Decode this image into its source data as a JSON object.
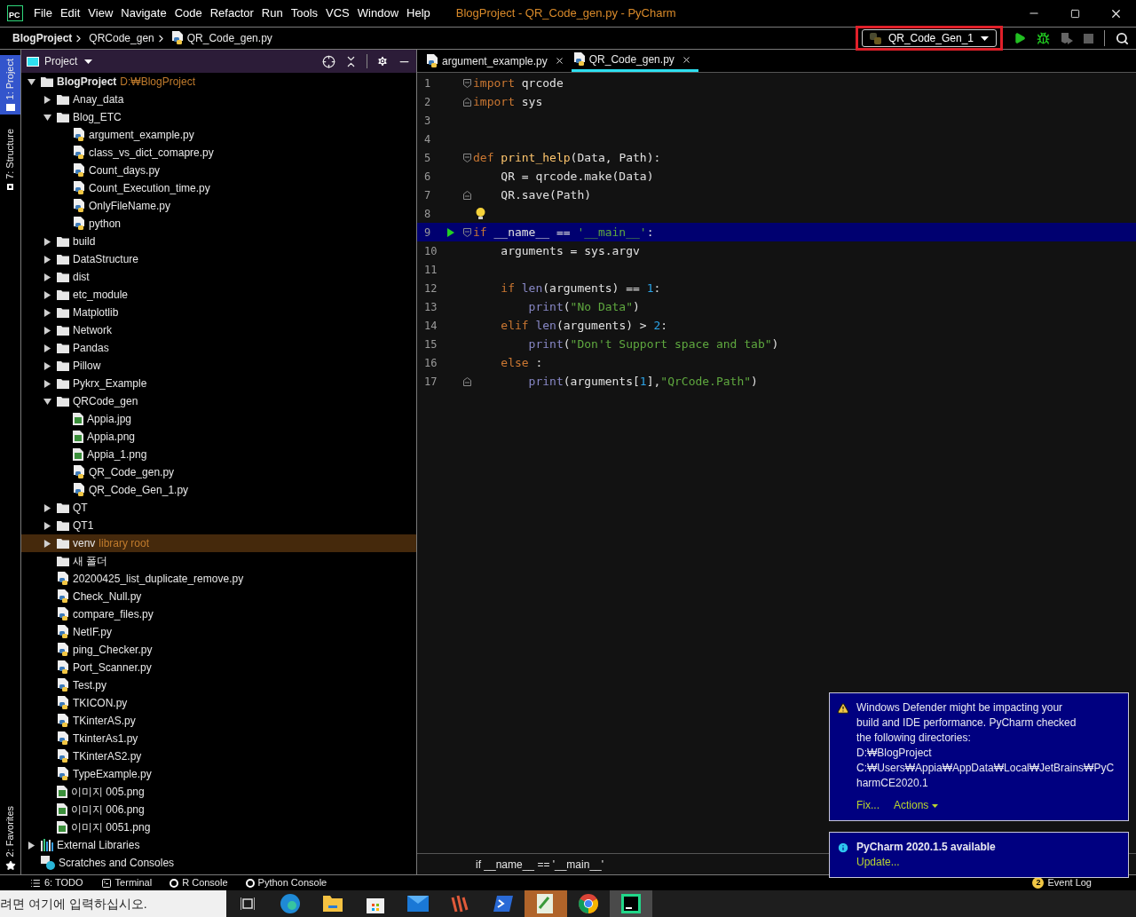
{
  "title_bar": {
    "logo": "PC",
    "menu": [
      "File",
      "Edit",
      "View",
      "Navigate",
      "Code",
      "Refactor",
      "Run",
      "Tools",
      "VCS",
      "Window",
      "Help"
    ],
    "title": "BlogProject - QR_Code_gen.py - PyCharm"
  },
  "nav_bar": {
    "breadcrumbs": [
      "BlogProject",
      "QRCode_gen",
      "QR_Code_gen.py"
    ],
    "run_config": "QR_Code_Gen_1"
  },
  "side_tabs": [
    {
      "label": "1: Project",
      "selected": true
    },
    {
      "label": "7: Structure",
      "selected": false
    }
  ],
  "favorites_tab": {
    "label": "2: Favorites"
  },
  "project_panel": {
    "title": "Project",
    "tree": [
      {
        "label": "BlogProject",
        "kind": "folder",
        "suffix": "D:₩BlogProject",
        "expanded": true,
        "selected": false,
        "children": [
          {
            "label": "Anay_data",
            "kind": "folder",
            "expanded": false,
            "selected": false
          },
          {
            "label": "Blog_ETC",
            "kind": "folder",
            "expanded": true,
            "selected": false,
            "children": [
              {
                "label": "argument_example.py",
                "kind": "python",
                "selected": false
              },
              {
                "label": "class_vs_dict_comapre.py",
                "kind": "python",
                "selected": false
              },
              {
                "label": "Count_days.py",
                "kind": "python",
                "selected": false
              },
              {
                "label": "Count_Execution_time.py",
                "kind": "python",
                "selected": false
              },
              {
                "label": "OnlyFileName.py",
                "kind": "python",
                "selected": false
              },
              {
                "label": "python",
                "kind": "python",
                "selected": false
              }
            ]
          },
          {
            "label": "build",
            "kind": "folder",
            "expanded": false,
            "selected": false
          },
          {
            "label": "DataStructure",
            "kind": "folder",
            "expanded": false,
            "selected": false
          },
          {
            "label": "dist",
            "kind": "folder",
            "expanded": false,
            "selected": false
          },
          {
            "label": "etc_module",
            "kind": "folder",
            "expanded": false,
            "selected": false
          },
          {
            "label": "Matplotlib",
            "kind": "folder",
            "expanded": false,
            "selected": false
          },
          {
            "label": "Network",
            "kind": "folder",
            "expanded": false,
            "selected": false
          },
          {
            "label": "Pandas",
            "kind": "folder",
            "expanded": false,
            "selected": false
          },
          {
            "label": "Pillow",
            "kind": "folder",
            "expanded": false,
            "selected": false
          },
          {
            "label": "Pykrx_Example",
            "kind": "folder",
            "expanded": false,
            "selected": false
          },
          {
            "label": "QRCode_gen",
            "kind": "folder",
            "expanded": true,
            "selected": false,
            "children": [
              {
                "label": "Appia.jpg",
                "kind": "image",
                "selected": false
              },
              {
                "label": "Appia.png",
                "kind": "image",
                "selected": false
              },
              {
                "label": "Appia_1.png",
                "kind": "image",
                "selected": false
              },
              {
                "label": "QR_Code_gen.py",
                "kind": "python",
                "selected": false
              },
              {
                "label": "QR_Code_Gen_1.py",
                "kind": "python",
                "selected": false
              }
            ]
          },
          {
            "label": "QT",
            "kind": "folder",
            "expanded": false,
            "selected": false
          },
          {
            "label": "QT1",
            "kind": "folder",
            "expanded": false,
            "selected": false
          },
          {
            "label": "venv",
            "kind": "folder",
            "suffix": "library root",
            "expanded": false,
            "selected": true
          },
          {
            "label": "새 폴더",
            "kind": "folder",
            "selected": false
          },
          {
            "label": "20200425_list_duplicate_remove.py",
            "kind": "python",
            "selected": false
          },
          {
            "label": "Check_Null.py",
            "kind": "python",
            "selected": false
          },
          {
            "label": "compare_files.py",
            "kind": "python",
            "selected": false
          },
          {
            "label": "NetIF.py",
            "kind": "python",
            "selected": false
          },
          {
            "label": "ping_Checker.py",
            "kind": "python",
            "selected": false
          },
          {
            "label": "Port_Scanner.py",
            "kind": "python",
            "selected": false
          },
          {
            "label": "Test.py",
            "kind": "python",
            "selected": false
          },
          {
            "label": "TKICON.py",
            "kind": "python",
            "selected": false
          },
          {
            "label": "TKinterAS.py",
            "kind": "python",
            "selected": false
          },
          {
            "label": "TkinterAs1.py",
            "kind": "python",
            "selected": false
          },
          {
            "label": "TKinterAS2.py",
            "kind": "python",
            "selected": false
          },
          {
            "label": "TypeExample.py",
            "kind": "python",
            "selected": false
          },
          {
            "label": "이미지 005.png",
            "kind": "image",
            "selected": false
          },
          {
            "label": "이미지 006.png",
            "kind": "image",
            "selected": false
          },
          {
            "label": "이미지 0051.png",
            "kind": "image",
            "selected": false
          }
        ]
      },
      {
        "label": "External Libraries",
        "kind": "library",
        "expanded": false,
        "selected": false
      },
      {
        "label": "Scratches and Consoles",
        "kind": "scratch",
        "selected": false
      }
    ]
  },
  "editor": {
    "tabs": [
      {
        "label": "argument_example.py",
        "selected": false
      },
      {
        "label": "QR_Code_gen.py",
        "selected": true
      }
    ],
    "lines": [
      {
        "n": "1",
        "fold": {
          "kind": "start"
        },
        "current": false,
        "run": false,
        "bulb": false,
        "tokens": [
          {
            "kind": "kw",
            "text": "import "
          },
          {
            "kind": "plain",
            "text": "qrcode"
          }
        ]
      },
      {
        "n": "2",
        "fold": {
          "kind": "end"
        },
        "current": false,
        "run": false,
        "bulb": false,
        "tokens": [
          {
            "kind": "kw",
            "text": "import "
          },
          {
            "kind": "plain",
            "text": "sys"
          }
        ]
      },
      {
        "n": "3",
        "current": false,
        "run": false,
        "bulb": false
      },
      {
        "n": "4",
        "current": false,
        "run": false,
        "bulb": false
      },
      {
        "n": "5",
        "fold": {
          "kind": "start"
        },
        "current": false,
        "run": false,
        "bulb": false,
        "tokens": [
          {
            "kind": "kw",
            "text": "def "
          },
          {
            "kind": "fn",
            "text": "print_help"
          },
          {
            "kind": "plain",
            "text": "(Data, Path):"
          }
        ]
      },
      {
        "n": "6",
        "current": false,
        "run": false,
        "bulb": false,
        "tokens": [
          {
            "kind": "plain",
            "text": "    QR = qrcode.make(Data)"
          }
        ]
      },
      {
        "n": "7",
        "fold": {
          "kind": "end"
        },
        "current": false,
        "run": false,
        "bulb": false,
        "tokens": [
          {
            "kind": "plain",
            "text": "    QR.save(Path)"
          }
        ]
      },
      {
        "n": "8",
        "current": false,
        "run": false,
        "bulb": true
      },
      {
        "n": "9",
        "fold": {
          "kind": "start"
        },
        "current": true,
        "run": true,
        "bulb": false,
        "tokens": [
          {
            "kind": "kw",
            "text": "if "
          },
          {
            "kind": "plain",
            "text": "__name__ == "
          },
          {
            "kind": "str",
            "text": "'__main__'"
          },
          {
            "kind": "plain",
            "text": ":"
          }
        ]
      },
      {
        "n": "10",
        "current": false,
        "run": false,
        "bulb": false,
        "tokens": [
          {
            "kind": "plain",
            "text": "    arguments = sys.argv"
          }
        ]
      },
      {
        "n": "11",
        "current": false,
        "run": false,
        "bulb": false
      },
      {
        "n": "12",
        "current": false,
        "run": false,
        "bulb": false,
        "tokens": [
          {
            "kind": "kw",
            "text": "    if "
          },
          {
            "kind": "builtin",
            "text": "len"
          },
          {
            "kind": "plain",
            "text": "(arguments) == "
          },
          {
            "kind": "num",
            "text": "1"
          },
          {
            "kind": "plain",
            "text": ":"
          }
        ]
      },
      {
        "n": "13",
        "current": false,
        "run": false,
        "bulb": false,
        "tokens": [
          {
            "kind": "builtin",
            "text": "        print"
          },
          {
            "kind": "plain",
            "text": "("
          },
          {
            "kind": "str",
            "text": "\"No Data\""
          },
          {
            "kind": "plain",
            "text": ")"
          }
        ]
      },
      {
        "n": "14",
        "current": false,
        "run": false,
        "bulb": false,
        "tokens": [
          {
            "kind": "kw",
            "text": "    elif "
          },
          {
            "kind": "builtin",
            "text": "len"
          },
          {
            "kind": "plain",
            "text": "(arguments) > "
          },
          {
            "kind": "num",
            "text": "2"
          },
          {
            "kind": "plain",
            "text": ":"
          }
        ]
      },
      {
        "n": "15",
        "current": false,
        "run": false,
        "bulb": false,
        "tokens": [
          {
            "kind": "builtin",
            "text": "        print"
          },
          {
            "kind": "plain",
            "text": "("
          },
          {
            "kind": "str",
            "text": "\"Don't Support space and tab\""
          },
          {
            "kind": "plain",
            "text": ")"
          }
        ]
      },
      {
        "n": "16",
        "current": false,
        "run": false,
        "bulb": false,
        "tokens": [
          {
            "kind": "kw",
            "text": "    else "
          },
          {
            "kind": "plain",
            "text": ":"
          }
        ]
      },
      {
        "n": "17",
        "fold": {
          "kind": "end"
        },
        "current": false,
        "run": false,
        "bulb": false,
        "tokens": [
          {
            "kind": "builtin",
            "text": "        print"
          },
          {
            "kind": "plain",
            "text": "(arguments["
          },
          {
            "kind": "num",
            "text": "1"
          },
          {
            "kind": "plain",
            "text": "],"
          },
          {
            "kind": "str",
            "text": "\"QrCode.Path\""
          },
          {
            "kind": "plain",
            "text": ")"
          }
        ]
      }
    ],
    "breadcrumb": "if __name__ == '__main__'"
  },
  "notifications": [
    {
      "kind": "warning",
      "lines": [
        "Windows Defender might be impacting your",
        "build and IDE performance. PyCharm checked",
        "the following directories:",
        "D:₩BlogProject",
        "C:₩Users₩Appia₩AppData₩Local₩JetBrains₩PyC",
        "harmCE2020.1"
      ],
      "actions": [
        "Fix...",
        "Actions"
      ]
    },
    {
      "kind": "info",
      "lines": [
        "PyCharm 2020.1.5 available"
      ],
      "actions": [
        "Update..."
      ]
    }
  ],
  "tool_windows": [
    "6: TODO",
    "Terminal",
    "R Console",
    "Python Console"
  ],
  "event_log": {
    "count": "2",
    "label": "Event Log"
  },
  "taskbar": {
    "search_placeholder": "려면 여기에 입력하십시오."
  }
}
